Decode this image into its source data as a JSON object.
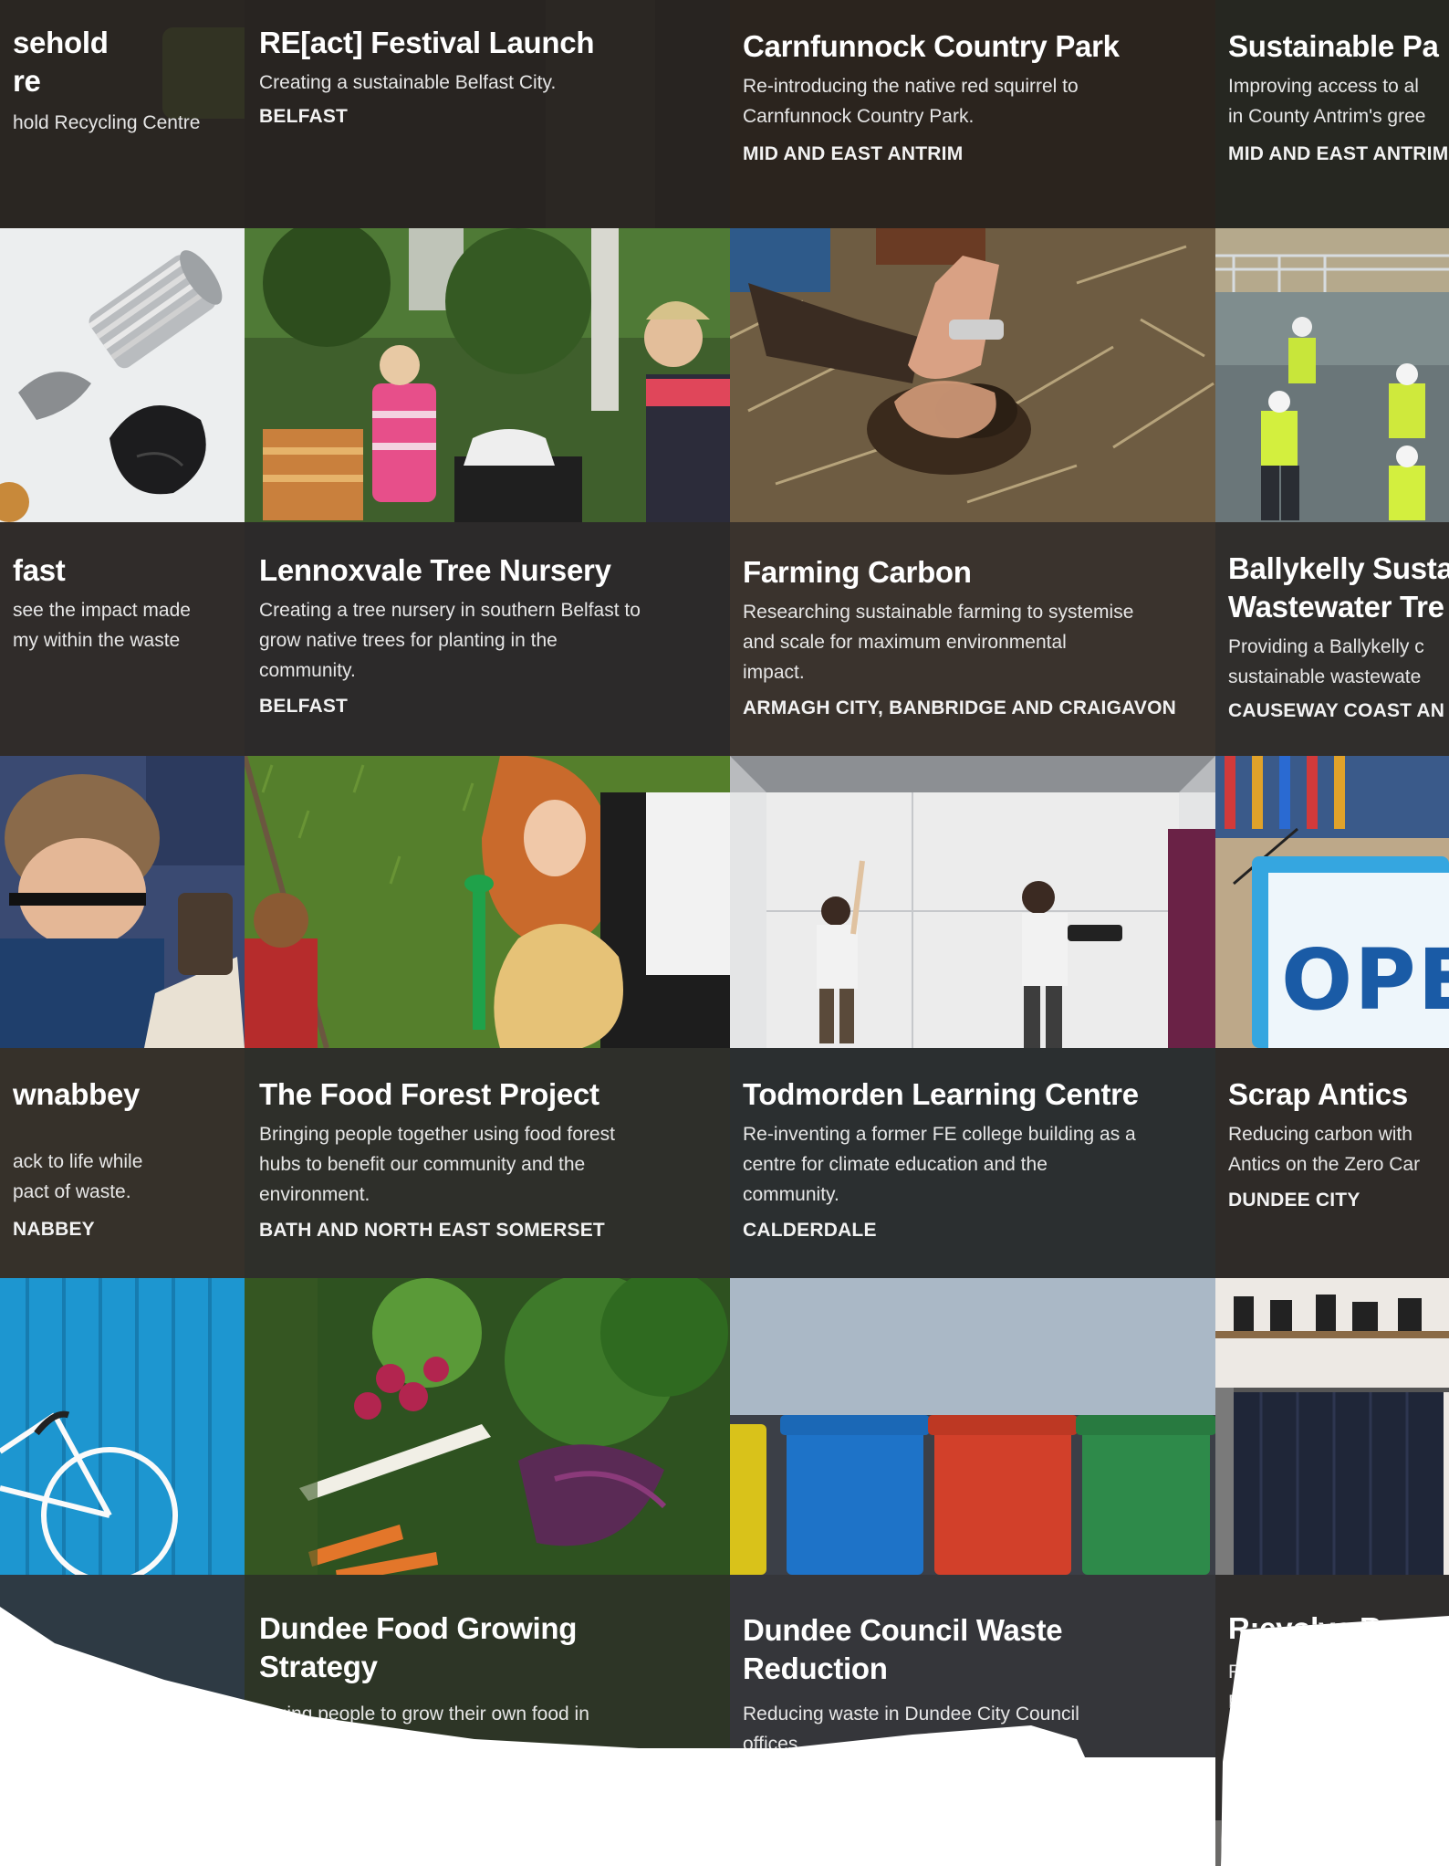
{
  "row1": [
    {
      "title_lines": [
        "sehold",
        "re"
      ],
      "desc": "hold Recycling Centre",
      "loc": ""
    },
    {
      "title_lines": [
        "RE[act] Festival Launch"
      ],
      "desc": "Creating a sustainable Belfast City.",
      "loc": "BELFAST"
    },
    {
      "title_lines": [
        "Carnfunnock Country Park"
      ],
      "desc_lines": [
        "Re-introducing the native red squirrel to",
        "Carnfunnock Country Park."
      ],
      "loc": "MID AND EAST ANTRIM"
    },
    {
      "title_lines": [
        "Sustainable Pa"
      ],
      "desc_lines": [
        "Improving access to al",
        "in County Antrim's gree"
      ],
      "loc": "MID AND EAST ANTRIM"
    }
  ],
  "row2": [
    {
      "title_lines": [
        "fast"
      ],
      "desc_lines": [
        "see the impact made",
        "my within the waste"
      ],
      "loc": ""
    },
    {
      "title_lines": [
        "Lennoxvale Tree Nursery"
      ],
      "desc_lines": [
        "Creating a tree nursery in southern Belfast to",
        "grow native trees for planting in the",
        "community."
      ],
      "loc": "BELFAST"
    },
    {
      "title_lines": [
        "Farming Carbon"
      ],
      "desc_lines": [
        "Researching sustainable farming to systemise",
        "and scale for maximum environmental",
        "impact."
      ],
      "loc": "ARMAGH CITY, BANBRIDGE AND CRAIGAVON"
    },
    {
      "title_lines": [
        "Ballykelly Susta",
        "Wastewater Tre"
      ],
      "desc_lines": [
        "Providing a Ballykelly c",
        "sustainable wastewate"
      ],
      "loc": "CAUSEWAY COAST AN"
    }
  ],
  "row3": [
    {
      "title_lines": [
        "wnabbey"
      ],
      "desc_lines": [
        "ack to life while",
        "pact of waste."
      ],
      "loc": "NABBEY"
    },
    {
      "title_lines": [
        "The Food Forest Project"
      ],
      "desc_lines": [
        "Bringing people together using food forest",
        "hubs to benefit our community and the",
        "environment."
      ],
      "loc": "BATH AND NORTH EAST SOMERSET"
    },
    {
      "title_lines": [
        "Todmorden Learning Centre"
      ],
      "desc_lines": [
        "Re-inventing a former FE college building as a",
        "centre for climate education and the",
        "community."
      ],
      "loc": "CALDERDALE"
    },
    {
      "title_lines": [
        "Scrap Antics"
      ],
      "desc_lines": [
        "Reducing carbon with",
        "Antics on the Zero Car"
      ],
      "loc": "DUNDEE CITY"
    }
  ],
  "row4": [
    {
      "title_lines": [],
      "desc_lines": [],
      "loc": ""
    },
    {
      "title_lines": [
        "Dundee Food Growing",
        "Strategy"
      ],
      "desc_lines": [
        "raging people to grow their own food in"
      ],
      "loc": ""
    },
    {
      "title_lines": [
        "Dundee Council Waste",
        "Reduction"
      ],
      "desc_lines": [
        "Reducing waste in Dundee City Council",
        "offices."
      ],
      "loc": ""
    },
    {
      "title_lines": [
        "R:evolve Recy"
      ],
      "desc_lines": [
        "Reducin",
        "R"
      ],
      "loc": ""
    }
  ],
  "signs": {
    "open_sign": "OPE"
  },
  "colors": {
    "overlay": "#262220",
    "text": "#ffffff",
    "bin_yellow": "#d9c21a",
    "bin_blue": "#1e73c8",
    "bin_red": "#d2402a",
    "bin_green": "#2e8a4a",
    "wall_blue": "#1f9ad4"
  },
  "images": [
    "can-and-bag-photo",
    "tree-nursery-volunteers-photo",
    "soil-in-hand-photo",
    "wastewater-plant-workers-photo",
    "child-at-table-photo",
    "children-planting-photo",
    "wall-painting-photo",
    "open-sign-photo",
    "bicycle-blue-wall-photo",
    "vegetables-photo",
    "recycling-bins-photo",
    "clothes-rack-photo"
  ]
}
